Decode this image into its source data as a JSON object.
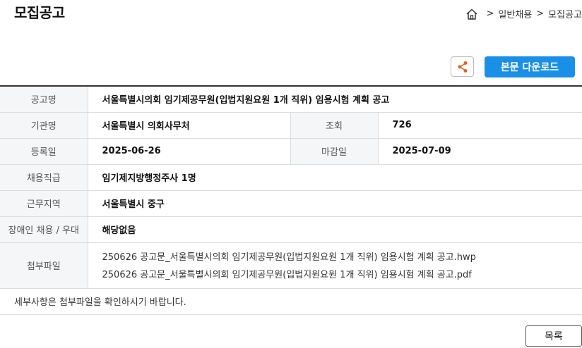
{
  "page_title": "모집공고",
  "breadcrumb": {
    "items": [
      "일반채용",
      "모집공고"
    ],
    "separator": ">"
  },
  "actions": {
    "download_label": "본문 다운로드",
    "list_label": "목록"
  },
  "accent_color": "#1a8fe6",
  "share_icon_color": "#e8601c",
  "info": {
    "title_label": "공고명",
    "title_value": "서울특별시의회 임기제공무원(입법지원요원 1개 직위) 임용시험 계획 공고",
    "agency_label": "기관명",
    "agency_value": "서울특별시 의회사무처",
    "views_label": "조회",
    "views_value": "726",
    "reg_label": "등록일",
    "reg_value": "2025-06-26",
    "deadline_label": "마감일",
    "deadline_value": "2025-07-09",
    "grade_label": "채용직급",
    "grade_value": "임기제지방행정주사 1명",
    "region_label": "근무지역",
    "region_value": "서울특별시 중구",
    "disabled_label": "장애인 채용 / 우대",
    "disabled_value": "해당없음",
    "files_label": "첨부파일",
    "files": [
      "250626 공고문_서울특별시의회 임기제공무원(입법지원요원 1개 직위) 임용시험 계획 공고.hwp",
      "250626 공고문_서울특별시의회 임기제공무원(입법지원요원 1개 직위) 임용시험 계획 공고.pdf"
    ],
    "note": "세부사항은 첨부파일을 확인하시기 바랍니다."
  }
}
